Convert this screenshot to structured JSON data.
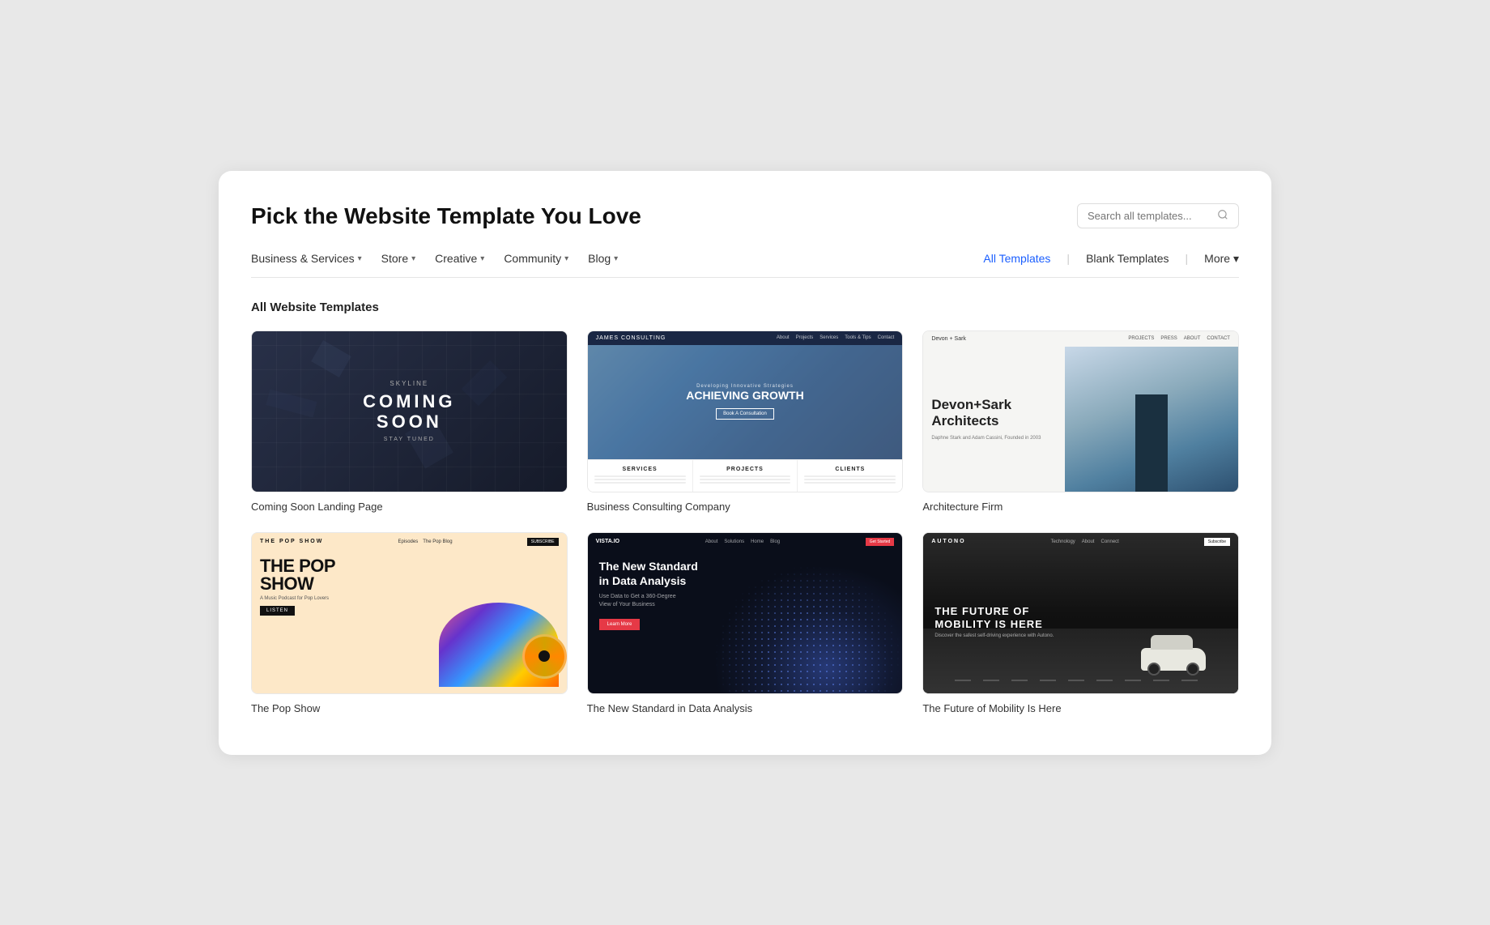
{
  "page": {
    "title": "Pick the Website Template You Love",
    "search_placeholder": "Search all templates..."
  },
  "nav": {
    "left_items": [
      {
        "id": "business",
        "label": "Business & Services",
        "has_dropdown": true
      },
      {
        "id": "store",
        "label": "Store",
        "has_dropdown": true
      },
      {
        "id": "creative",
        "label": "Creative",
        "has_dropdown": true
      },
      {
        "id": "community",
        "label": "Community",
        "has_dropdown": true
      },
      {
        "id": "blog",
        "label": "Blog",
        "has_dropdown": true
      }
    ],
    "right_items": [
      {
        "id": "all-templates",
        "label": "All Templates",
        "active": true
      },
      {
        "id": "blank-templates",
        "label": "Blank Templates",
        "active": false
      },
      {
        "id": "more",
        "label": "More",
        "has_dropdown": true
      }
    ]
  },
  "section": {
    "title": "All Website Templates"
  },
  "templates": [
    {
      "id": "coming-soon",
      "name": "Coming Soon Landing Page",
      "type": "coming-soon"
    },
    {
      "id": "business-consulting",
      "name": "Business Consulting Company",
      "type": "consulting"
    },
    {
      "id": "architecture-firm",
      "name": "Architecture Firm",
      "type": "architecture"
    },
    {
      "id": "pop-show",
      "name": "The Pop Show",
      "type": "pop"
    },
    {
      "id": "data-analysis",
      "name": "The New Standard in Data Analysis",
      "type": "data"
    },
    {
      "id": "autonomous-car",
      "name": "The Future of Mobility",
      "type": "auto"
    }
  ],
  "template_content": {
    "coming_soon": {
      "label": "SKYLINE",
      "heading_line1": "COMING",
      "heading_line2": "SOON",
      "sub": "STAY TUNED"
    },
    "consulting": {
      "logo": "JAMES CONSULTING",
      "tagline": "Developing Innovative Strategies",
      "headline": "ACHIEVING GROWTH",
      "cta": "Book A Consultation",
      "services": [
        "SERVICES",
        "PROJECTS",
        "CLIENTS"
      ]
    },
    "architecture": {
      "logo": "Devon + Sark",
      "nav_links": [
        "PROJECTS",
        "PRESS",
        "ABOUT",
        "CONTACT"
      ],
      "firm_name": "Devon+Sark Architects",
      "founded": "Daphne Stark and Adam Cassini, Founded in 2003"
    },
    "pop": {
      "logo": "THE POP SHOW",
      "nav_links": [
        "Episodes",
        "The Pop Blog"
      ],
      "subscribe": "SUBSCRIBE",
      "title_line1": "THE POP",
      "title_line2": "SHOW",
      "subtitle": "A Music Podcast for Pop Lovers",
      "cta": "LISTEN"
    },
    "data": {
      "logo": "VISTA.IO",
      "headline_line1": "The New Standard",
      "headline_line2": "in Data Analysis",
      "subtext_line1": "Use Data to Get a 360-Degree",
      "subtext_line2": "View of Your Business",
      "cta": "Learn More"
    },
    "auto": {
      "logo": "AUTONO",
      "headline_line1": "THE FUTURE OF",
      "headline_line2": "MOBILITY IS HERE",
      "subtext": "Discover the safest self-driving experience with Autono.",
      "subscribe": "Subscribe"
    }
  },
  "colors": {
    "accent_blue": "#1a5eff",
    "nav_separator": "#cccccc"
  }
}
